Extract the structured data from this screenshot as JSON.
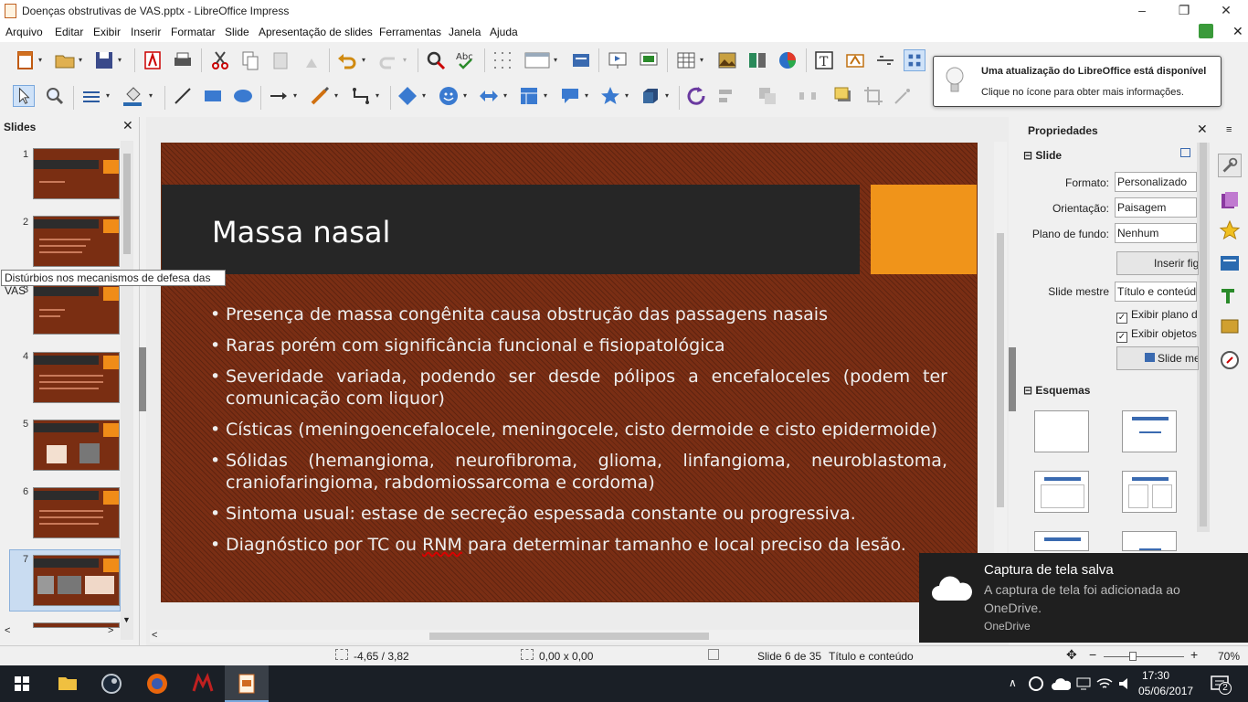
{
  "window": {
    "title": "Doenças obstrutivas de VAS.pptx - LibreOffice Impress"
  },
  "menu": [
    "Arquivo",
    "Editar",
    "Exibir",
    "Inserir",
    "Formatar",
    "Slide",
    "Apresentação de slides",
    "Ferramentas",
    "Janela",
    "Ajuda"
  ],
  "notification": {
    "title": "Uma atualização do LibreOffice está disponível",
    "body": "Clique no ícone para obter mais informações."
  },
  "slides_panel": {
    "title": "Slides",
    "numbers": [
      "1",
      "2",
      "3",
      "4",
      "5",
      "6",
      "7"
    ],
    "tooltip": "Distúrbios nos mecanismos de defesa das VAS"
  },
  "slide": {
    "title": "Massa nasal",
    "bullets": [
      "Presença de massa congênita causa obstrução das passagens nasais",
      "Raras porém com significância funcional e fisiopatológica",
      "Severidade variada, podendo ser desde pólipos a encefaloceles (podem ter comunicação com liquor)",
      "Císticas (meningoencefalocele, meningocele, cisto dermoide e cisto epidermoide)",
      "Sólidas (hemangioma, neurofibroma, glioma, linfangioma, neuroblastoma, craniofaringioma, rabdomiossarcoma e cordoma)",
      "Sintoma usual: estase de secreção espessada constante ou progressiva."
    ],
    "last_bullet_pre": "Diagnóstico por TC ou ",
    "last_bullet_spell": "RNM",
    "last_bullet_post": " para determinar tamanho e local preciso da lesão."
  },
  "properties": {
    "title": "Propriedades",
    "section_slide": "Slide",
    "formato_label": "Formato:",
    "formato_value": "Personalizado",
    "orientacao_label": "Orientação:",
    "orientacao_value": "Paisagem",
    "fundo_label": "Plano de fundo:",
    "fundo_value": "Nenhum",
    "inserir_btn": "Inserir figura",
    "mestre_label": "Slide mestre",
    "mestre_value": "Título e conteúdo",
    "chk1": "Exibir plano de fundo",
    "chk2": "Exibir objetos mestre",
    "mestre_btn": "Slide mestre",
    "section_esquemas": "Esquemas"
  },
  "toast": {
    "title": "Captura de tela salva",
    "body": "A captura de tela foi adicionada ao OneDrive.",
    "source": "OneDrive"
  },
  "status": {
    "position": "-4,65 / 3,82",
    "size": "0,00 x 0,00",
    "slide": "Slide 6 de 35",
    "layout": "Título e conteúdo",
    "zoom": "70%"
  },
  "taskbar": {
    "time": "17:30",
    "date": "05/06/2017",
    "badge": "2"
  },
  "colors": {
    "slide_bg": "#7a2e14",
    "title_bar": "#262626",
    "accent": "#f0941a"
  }
}
